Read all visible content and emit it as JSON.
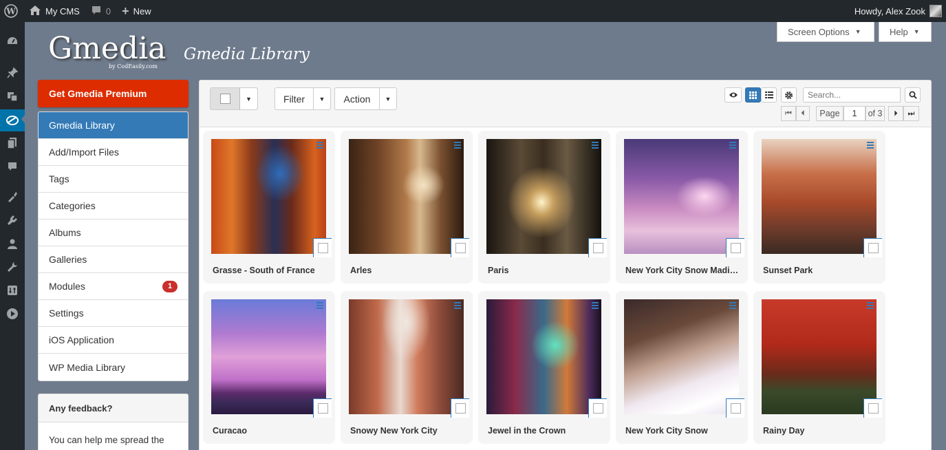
{
  "admin_bar": {
    "site_name": "My CMS",
    "comments_count": "0",
    "new_label": "New",
    "howdy": "Howdy, Alex Zook"
  },
  "admin_menu": {
    "icons": [
      "dashboard-icon",
      "pin-icon",
      "media-icon",
      "gmedia-icon",
      "pages-icon",
      "comments-icon",
      "appearance-icon",
      "plugins-icon",
      "users-icon",
      "tools-icon",
      "settings-icon",
      "play-icon"
    ]
  },
  "header": {
    "logo_text": "Gmedia",
    "logo_sub": "by CodEasily.com",
    "page_title": "Gmedia Library",
    "screen_options": "Screen Options",
    "help": "Help"
  },
  "sidebar": {
    "premium_label": "Get Gmedia Premium",
    "items": [
      {
        "label": "Gmedia Library",
        "active": true
      },
      {
        "label": "Add/Import Files"
      },
      {
        "label": "Tags"
      },
      {
        "label": "Categories"
      },
      {
        "label": "Albums"
      },
      {
        "label": "Galleries"
      },
      {
        "label": "Modules",
        "badge": "1"
      },
      {
        "label": "Settings"
      },
      {
        "label": "iOS Application"
      },
      {
        "label": "WP Media Library"
      }
    ],
    "feedback_title": "Any feedback?",
    "feedback_text": "You can help me spread the word about GmediaGallery"
  },
  "toolbar": {
    "filter_label": "Filter",
    "action_label": "Action",
    "search_placeholder": "Search...",
    "page_label": "Page",
    "page_current": "1",
    "page_of": "of 3"
  },
  "gallery": {
    "items": [
      {
        "title": "Grasse - South of France"
      },
      {
        "title": "Arles"
      },
      {
        "title": "Paris"
      },
      {
        "title": "New York City Snow Madison Square Park"
      },
      {
        "title": "Sunset Park"
      },
      {
        "title": "Curacao"
      },
      {
        "title": "Snowy New York City"
      },
      {
        "title": "Jewel in the Crown"
      },
      {
        "title": "New York City Snow"
      },
      {
        "title": "Rainy Day"
      }
    ]
  },
  "colors": {
    "admin_bar_bg": "#23282d",
    "page_bg": "#6e7b8c",
    "premium_red": "#dd2c00",
    "active_blue": "#337ab7",
    "badge_red": "#c9302c"
  }
}
